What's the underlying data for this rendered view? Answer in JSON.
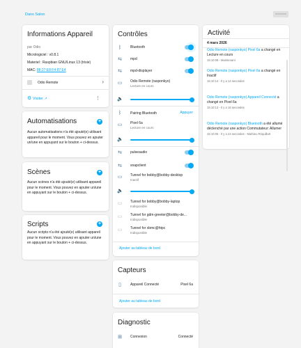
{
  "header": {
    "area_link": "Dans Salon"
  },
  "info": {
    "title": "Informations Appareil",
    "by": "par Odio",
    "firmware": "Micrologiciel : v0.8.1",
    "hardware": "Materiel : Raspbian GNU/Linux 13 (trixie)",
    "mac_label": "MAC:",
    "mac_value": "88:27:E8:F4:87:E4",
    "integration": "Odio Remote",
    "visit_label": "Visiter"
  },
  "automations": {
    "title": "Automatisations",
    "text": "Aucun automatisations n'a été ajouté(e) utilisant appareil pour le moment. Vous pouvez en ajouter un/une en appuyant sur le bouton + ci-dessus."
  },
  "scenes": {
    "title": "Scènes",
    "text": "Aucun scènes n'a été ajouté(e) utilisant appareil pour le moment. Vous pouvez en ajouter un/une en appuyant sur le bouton + ci-dessus."
  },
  "scripts": {
    "title": "Scripts",
    "text": "Aucun scripts n'a été ajouté(e) utilisant appareil pour le moment. Vous pouvez en ajouter un/une en appuyant sur le bouton + ci-dessus."
  },
  "controls": {
    "title": "Contrôles",
    "bluetooth": "Bluetooth",
    "mpd": "mpd",
    "mpd_display": "mpd-displayer",
    "odio_player": "Odio Remote (rasponkyo)",
    "odio_player_state": "Lecture en cours",
    "pairing": "Pairing Bluetooth",
    "pairing_action": "Appuyer",
    "pixel": "Pixel 6a",
    "pixel_state": "Lecture en cours",
    "pulse": "pulseaudio",
    "snapclient": "snapclient",
    "tunnel_desktop": "Tunnel for bobby@bobby-desktop",
    "tunnel_desktop_state": "Inactif",
    "tunnel_laptop": "Tunnel for bobby@bobby-laptop",
    "tunnel_laptop_state": "Indisponible",
    "tunnel_gdm": "Tunnel for gdm-greeter@bobby-de...",
    "tunnel_gdm_state": "Indisponible",
    "tunnel_xbmc": "Tunnel for xbmc@htpc",
    "tunnel_xbmc_state": "Indisponible",
    "add_link": "Ajouter au tableau de bord"
  },
  "sensors": {
    "title": "Capteurs",
    "device_label": "Appareil Connecté",
    "device_value": "Pixel 6a",
    "add_link": "Ajouter au tableau de bord"
  },
  "diagnostic": {
    "title": "Diagnostic",
    "conn_label": "Connexion",
    "conn_value": "Connecté"
  },
  "activity": {
    "title": "Activité",
    "date": "4 mars 2026",
    "items": [
      {
        "entity": "Odio Remote (rasponkyo) Pixel 6a",
        "text": "a changé en Lecture en cours",
        "ts": "15:10:08 - Maintenant"
      },
      {
        "entity": "Odio Remote (rasponkyo) Pixel 6a",
        "text": "a changé en Inactif",
        "ts": "15:10:14 - Il y a 14 secondes"
      },
      {
        "entity": "Odio Remote (rasponkyo) Appareil Connecté",
        "text": "a changé en Pixel 6a",
        "ts": "15:10:13 - Il y a 16 secondes"
      },
      {
        "entity": "Odio Remote (rasponkyo) Bluetooth",
        "text": "a été allumé déclenché par une action Commutateur: Allumer",
        "ts": "15:10:05 - Il y a 24 secondes - Mathieu Réquillart"
      }
    ]
  }
}
